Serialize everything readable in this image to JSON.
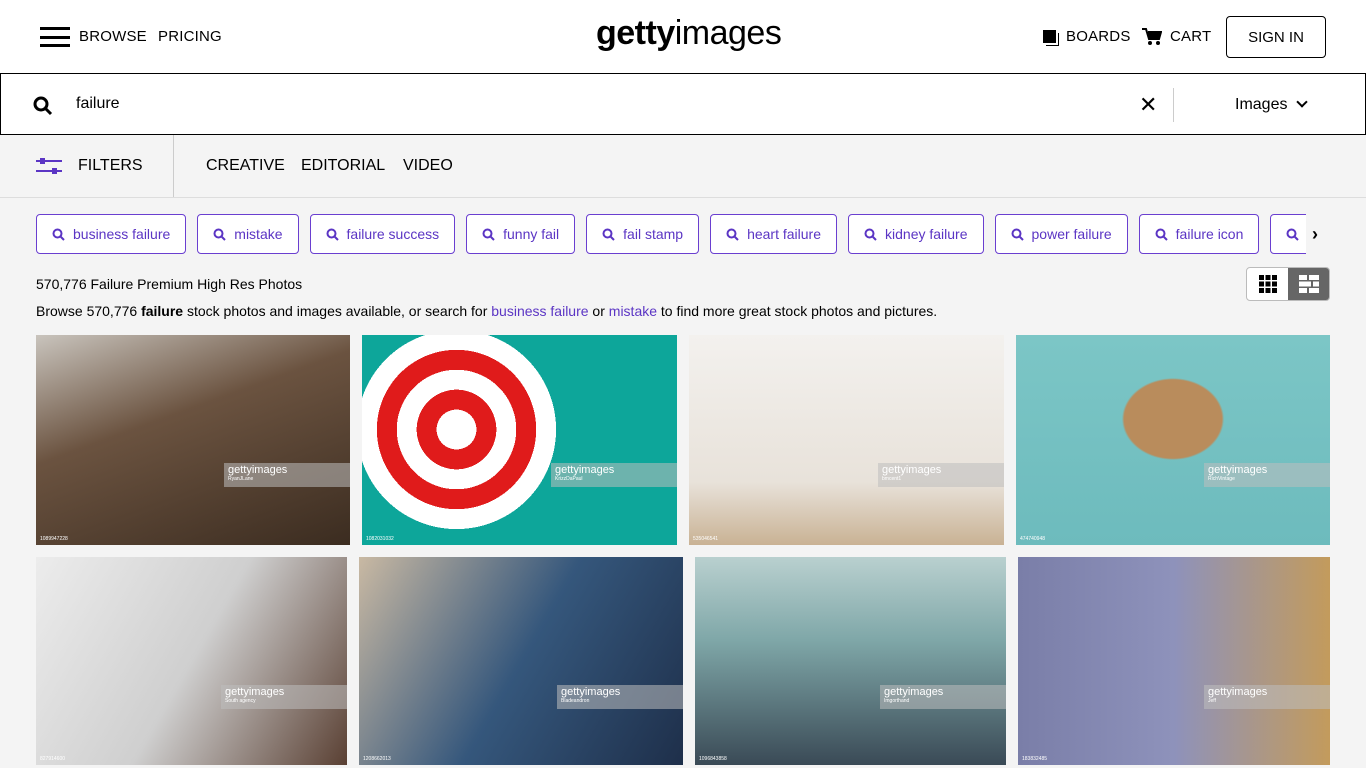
{
  "header": {
    "browse": "BROWSE",
    "pricing": "PRICING",
    "logo_bold": "getty",
    "logo_light": "images",
    "boards": "BOARDS",
    "cart": "CART",
    "signin": "SIGN IN"
  },
  "search": {
    "query": "failure",
    "type": "Images"
  },
  "filters": {
    "label": "FILTERS",
    "tabs": [
      "CREATIVE",
      "EDITORIAL",
      "VIDEO"
    ]
  },
  "chips": [
    "business failure",
    "mistake",
    "failure success",
    "funny fail",
    "fail stamp",
    "heart failure",
    "kidney failure",
    "power failure",
    "failure icon",
    ""
  ],
  "results": {
    "count_title": "570,776 Failure Premium High Res Photos",
    "desc_pre": "Browse 570,776 ",
    "desc_bold": "failure",
    "desc_mid": " stock photos and images available, or search for ",
    "link1": "business failure",
    "desc_or": " or ",
    "link2": "mistake",
    "desc_post": " to find more great stock photos and pictures."
  },
  "colors": {
    "accent": "#5b35c4"
  },
  "images": [
    {
      "credit": "RyanJLane",
      "id": "1089947228"
    },
    {
      "credit": "KrizzDaPaul",
      "id": "1082031032"
    },
    {
      "credit": "bmcent1",
      "id": "535046541"
    },
    {
      "credit": "RichVintage",
      "id": "474740948"
    },
    {
      "credit": "South agency",
      "id": "827914600"
    },
    {
      "credit": "Bladeandron",
      "id": "1208662013"
    },
    {
      "credit": "Imgorthand",
      "id": "1096843858"
    },
    {
      "credit": "Jeff",
      "id": "183832485"
    }
  ],
  "watermark": "gettyimages"
}
